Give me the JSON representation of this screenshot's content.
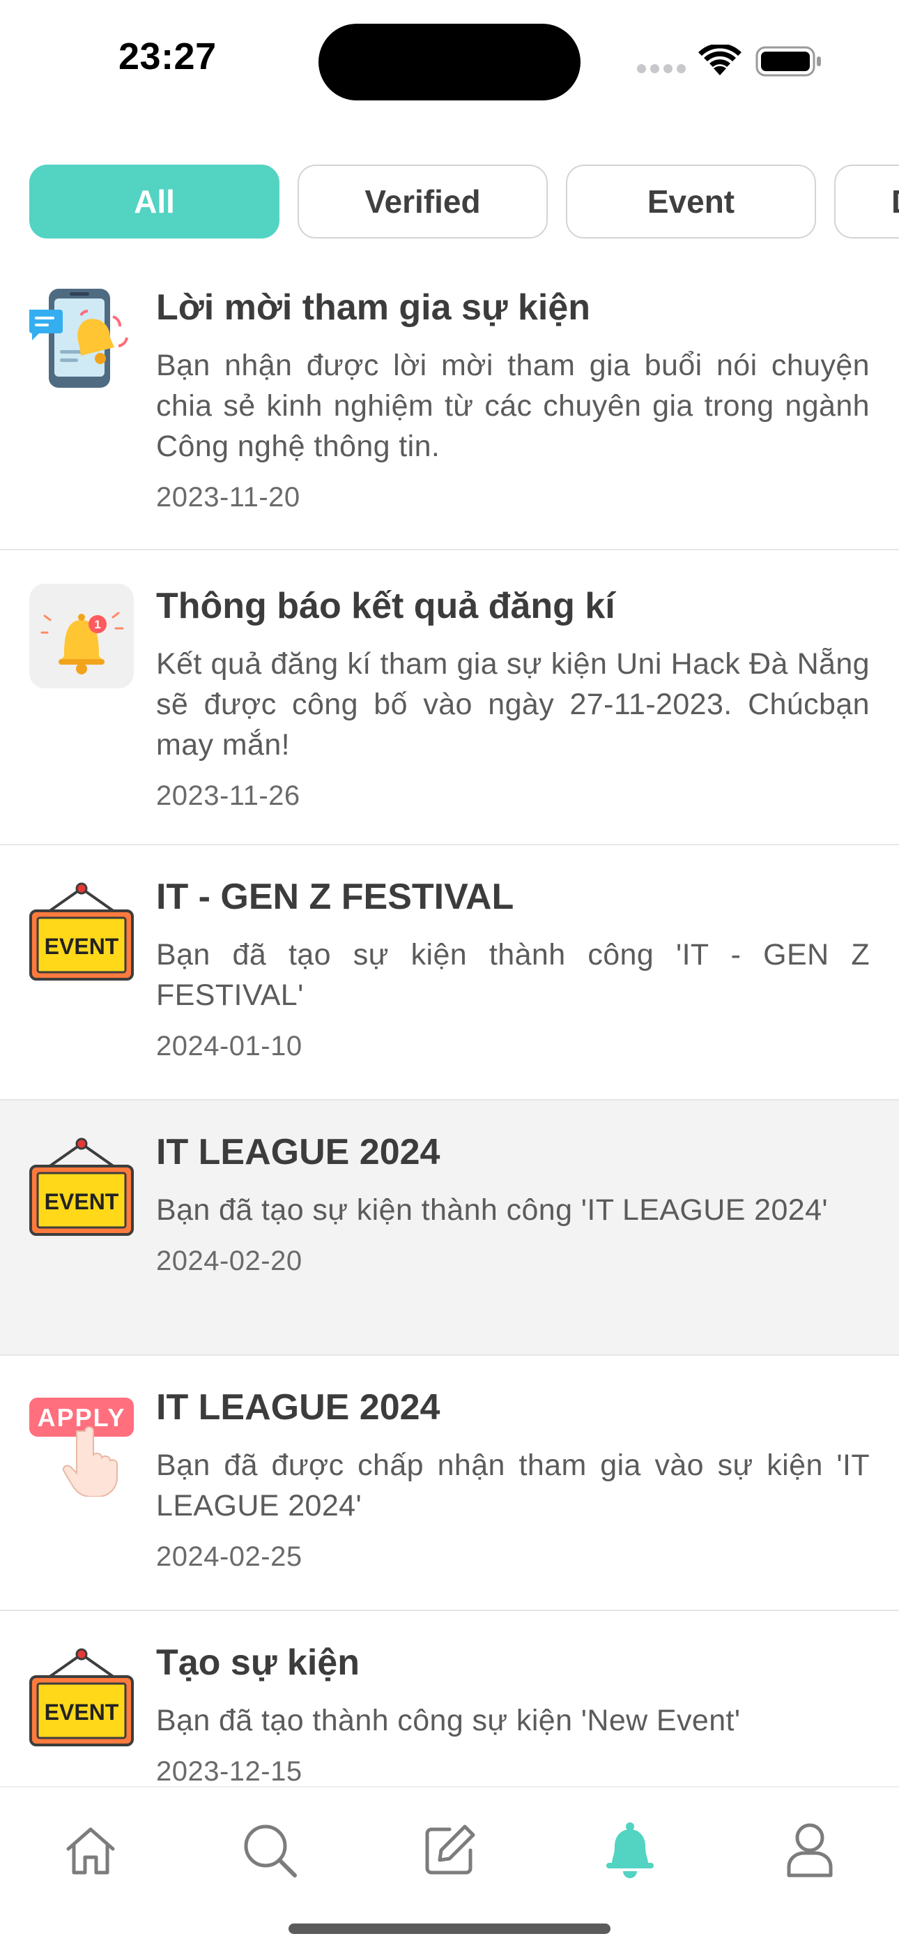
{
  "status_bar": {
    "time": "23:27"
  },
  "filters": [
    {
      "label": "All",
      "active": true
    },
    {
      "label": "Verified",
      "active": false
    },
    {
      "label": "Event",
      "active": false
    },
    {
      "label": "D",
      "active": false
    }
  ],
  "notifications": [
    {
      "icon": "phone-notification-icon",
      "title": "Lời mời tham gia sự kiện",
      "body": "Bạn nhận được lời mời tham gia buổi nói chuyện chia sẻ kinh nghiệm từ các chuyên gia trong ngành Công nghệ thông tin.",
      "date": "2023-11-20"
    },
    {
      "icon": "bell-alert-icon",
      "title": "Thông báo kết quả đăng kí",
      "body": "Kết quả đăng kí tham gia sự kiện Uni Hack Đà Nẵng sẽ được công bố vào ngày 27-11-2023. Chúcbạn may mắn!",
      "date": "2023-11-26"
    },
    {
      "icon": "event-sign-icon",
      "icon_text": "EVENT",
      "title": "IT - GEN Z FESTIVAL",
      "body": "Bạn đã tạo sự kiện thành công 'IT - GEN Z FESTIVAL'",
      "date": "2024-01-10"
    },
    {
      "icon": "event-sign-icon",
      "icon_text": "EVENT",
      "title": "IT LEAGUE 2024",
      "body": "Bạn đã tạo sự kiện thành công 'IT LEAGUE 2024'",
      "date": "2024-02-20",
      "highlighted": true
    },
    {
      "icon": "apply-hand-icon",
      "icon_text": "APPLY",
      "title": "IT LEAGUE 2024",
      "body": "Bạn đã được chấp nhận tham gia vào sự kiện 'IT LEAGUE 2024'",
      "date": "2024-02-25"
    },
    {
      "icon": "event-sign-icon",
      "icon_text": "EVENT",
      "title": "Tạo sự kiện",
      "body": "Bạn đã tạo thành công sự kiện 'New Event'",
      "date": "2023-12-15"
    }
  ],
  "tab_bar": {
    "tabs": [
      {
        "icon": "home-icon",
        "active": false
      },
      {
        "icon": "search-icon",
        "active": false
      },
      {
        "icon": "edit-icon",
        "active": false
      },
      {
        "icon": "bell-icon",
        "active": true
      },
      {
        "icon": "profile-icon",
        "active": false
      }
    ]
  },
  "colors": {
    "accent": "#53d3c2",
    "text": "#3c3c3c",
    "muted": "#5b5b5b",
    "highlight_bg": "#f3f3f3",
    "event_yellow": "#ffd81a"
  }
}
